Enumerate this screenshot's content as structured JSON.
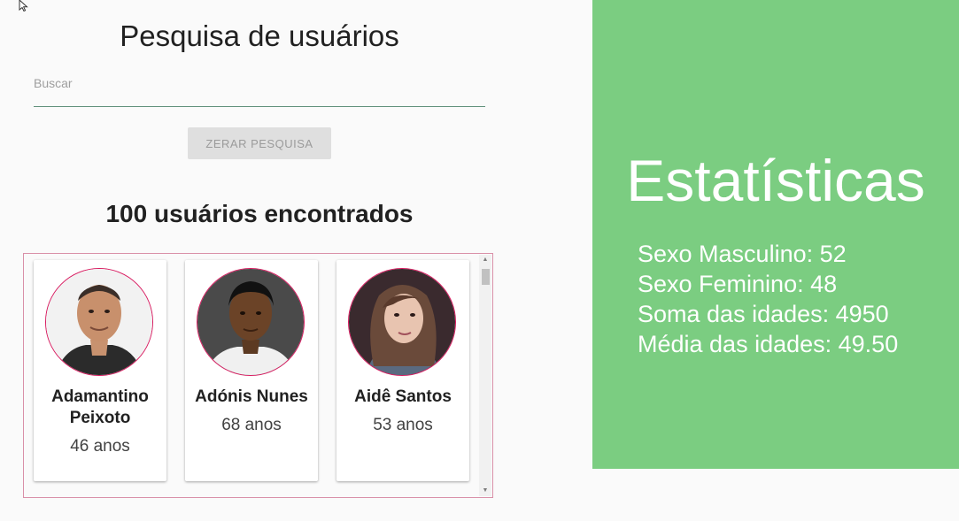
{
  "page": {
    "title": "Pesquisa de usuários",
    "search": {
      "placeholder": "Buscar",
      "value": ""
    },
    "reset_button_label": "ZERAR PESQUISA",
    "results_count": "100 usuários encontrados"
  },
  "users": [
    {
      "name_line1": "Adamantino",
      "name_line2": "Peixoto",
      "age": "46 anos"
    },
    {
      "name_line1": "Adónis Nunes",
      "name_line2": "",
      "age": "68 anos"
    },
    {
      "name_line1": "Aidê Santos",
      "name_line2": "",
      "age": "53 anos"
    }
  ],
  "stats": {
    "title": "Estatísticas",
    "male": "Sexo Masculino: 52",
    "female": "Sexo Feminino: 48",
    "age_sum": "Soma das idades: 4950",
    "age_avg": "Média das idades: 49.50"
  },
  "colors": {
    "stats_background": "#7bcd81",
    "avatar_border": "#d81b60",
    "input_underline": "#5f8f7a",
    "button_background": "#dfdfdf"
  },
  "icons": {
    "cursor": "mouse-pointer-icon",
    "scroll_up": "triangle-up-icon",
    "scroll_down": "triangle-down-icon"
  }
}
